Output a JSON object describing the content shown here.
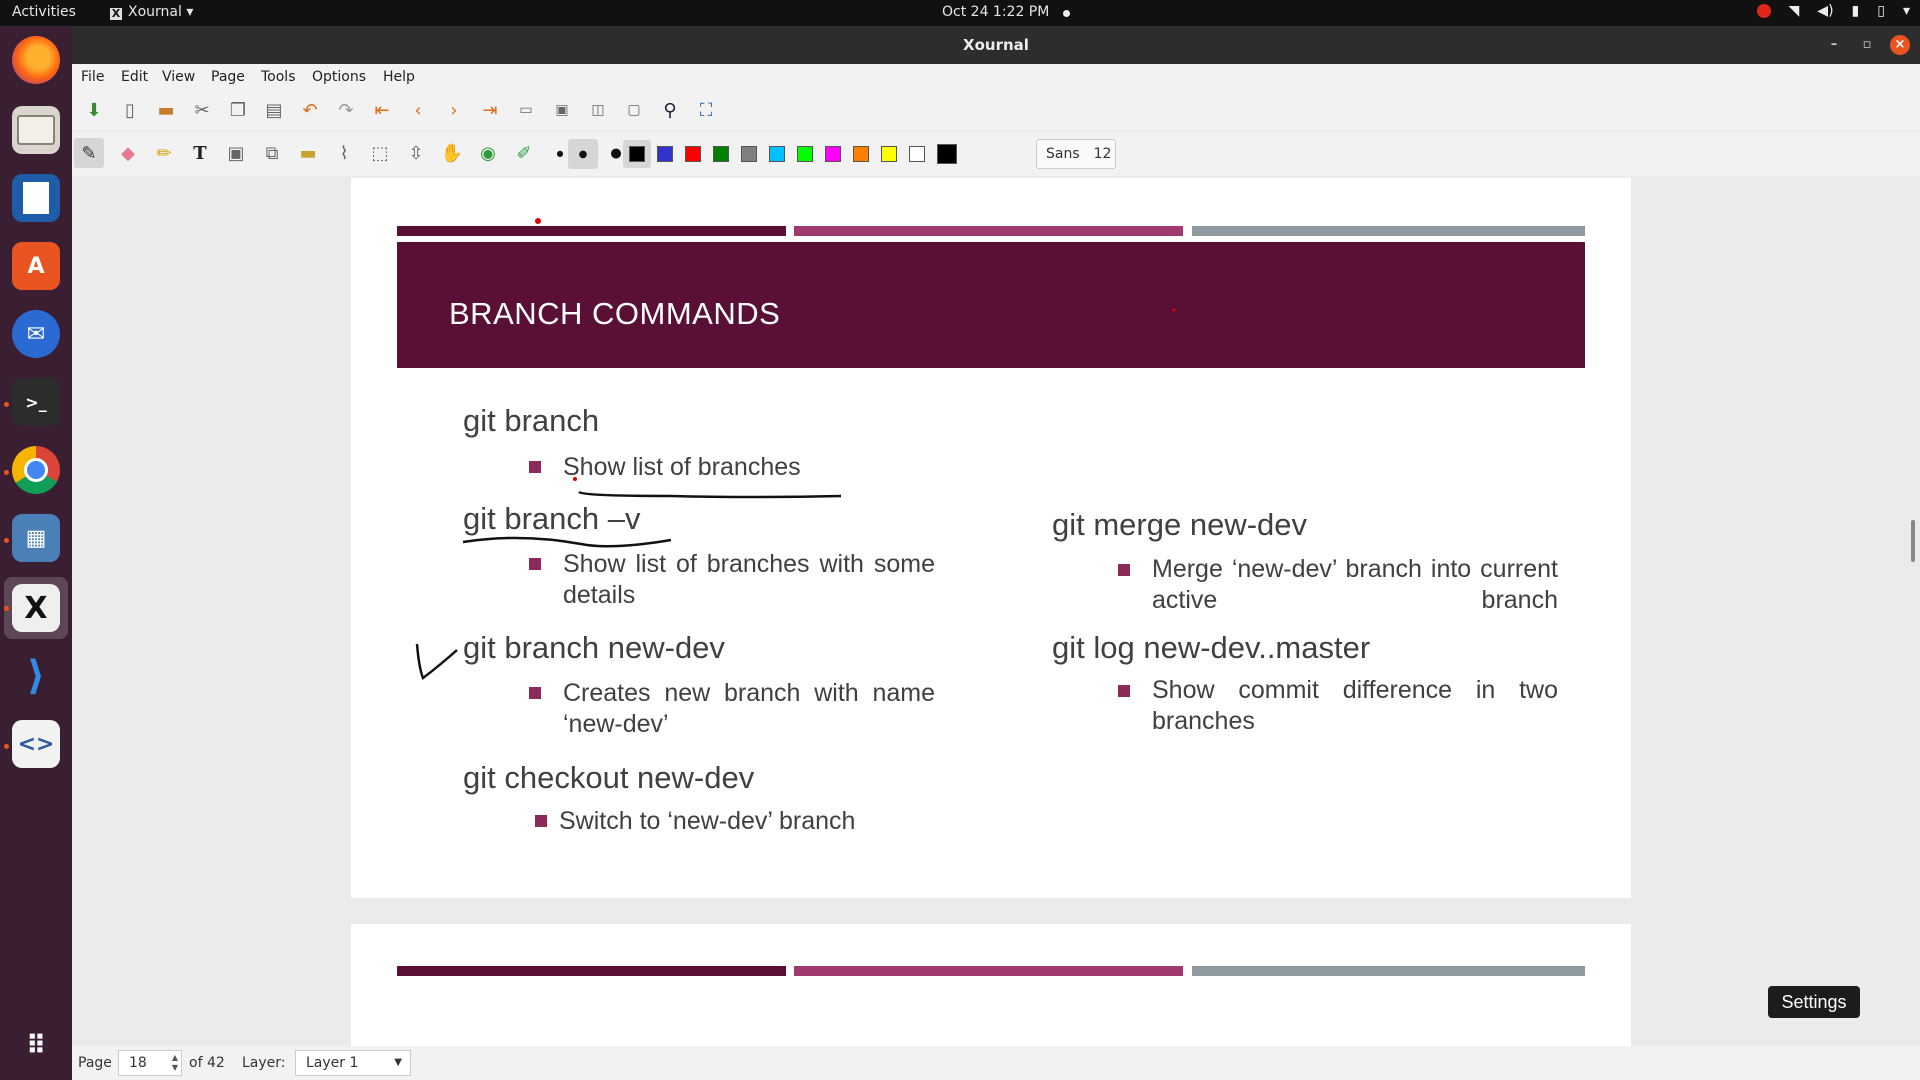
{
  "topbar": {
    "activities": "Activities",
    "app_name": "Xournal",
    "app_caret": "▾",
    "clock": "Oct 24  1:22 PM"
  },
  "window": {
    "title": "Xournal",
    "minimize": "–",
    "maximize": "▫",
    "close": "×"
  },
  "menu": [
    "File",
    "Edit",
    "View",
    "Page",
    "Tools",
    "Options",
    "Help"
  ],
  "toolbar2": {
    "font_name": "Sans",
    "font_size": "12",
    "colors": [
      "#000000",
      "#3333cc",
      "#ff0000",
      "#008000",
      "#808080",
      "#00c0ff",
      "#00ff00",
      "#ff00ff",
      "#ff8000",
      "#ffff00",
      "#ffffff",
      "#000000"
    ]
  },
  "slide": {
    "title": "BRANCH COMMANDS",
    "left": [
      {
        "cmd": "git branch",
        "desc": "Show list of branches"
      },
      {
        "cmd": "git branch –v",
        "desc": "Show list of branches with some details"
      },
      {
        "cmd": "git branch new-dev",
        "desc": "Creates new branch with name ‘new-dev’"
      },
      {
        "cmd": "git checkout new-dev",
        "desc": "Switch to ‘new-dev’ branch"
      }
    ],
    "right": [
      {
        "cmd": "git merge new-dev",
        "desc": "Merge ‘new-dev’ branch into current active branch"
      },
      {
        "cmd": "git log new-dev..master",
        "desc": "Show commit difference in two branches"
      }
    ],
    "bar_colors": [
      "#5a0f36",
      "#a03a6e",
      "#8e9aa0"
    ]
  },
  "status": {
    "page_label": "Page",
    "page_value": "18",
    "page_total": "of 42",
    "layer_label": "Layer:",
    "layer_value": "Layer 1"
  },
  "tooltip": "Settings"
}
